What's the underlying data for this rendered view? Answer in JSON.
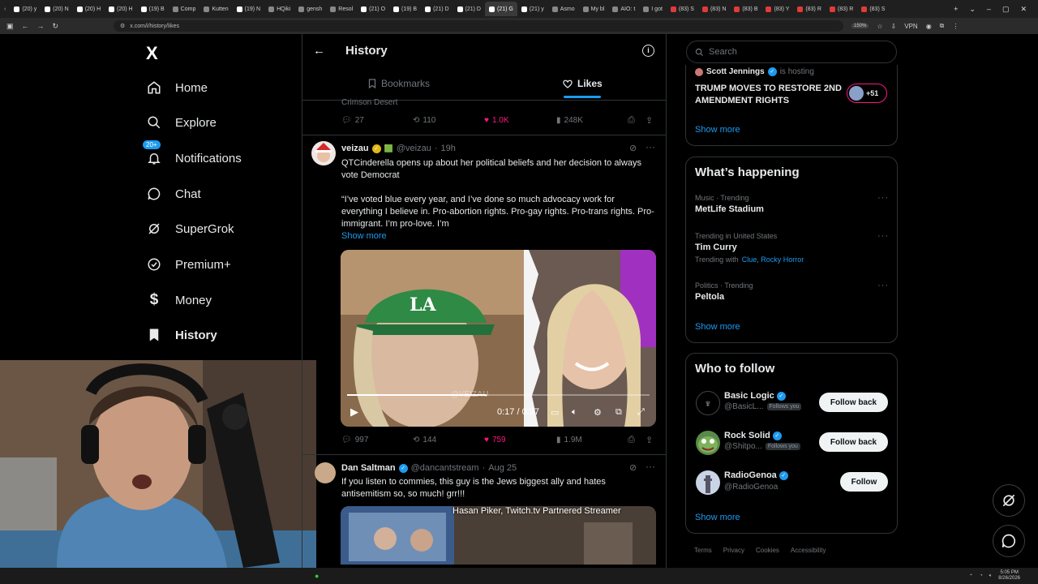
{
  "browser": {
    "tabs": [
      "(20) y",
      "(20) N",
      "(20) H",
      "(20) H",
      "(19) B",
      "Comp",
      "Kutten",
      "(19) N",
      "HQiki",
      "gensh",
      "Resol",
      "(21) O",
      "(19) B",
      "(21) D",
      "(21) D",
      "(21) G",
      "(21) y",
      "Asmo",
      "My bl",
      "AIO: t",
      "I got",
      "(83) S",
      "(83) N",
      "(83) B",
      "(83) Y",
      "(83) R",
      "(83) R",
      "(83) S"
    ],
    "active_tab_index": 15,
    "url": "x.com/i/history/likes",
    "zoom": "150%",
    "vpn_label": "VPN"
  },
  "sidebar": {
    "logo": "X",
    "items": [
      {
        "label": "Home",
        "icon": "home-icon"
      },
      {
        "label": "Explore",
        "icon": "search-icon"
      },
      {
        "label": "Notifications",
        "icon": "bell-icon",
        "badge": "20+"
      },
      {
        "label": "Chat",
        "icon": "chat-icon"
      },
      {
        "label": "SuperGrok",
        "icon": "grok-icon"
      },
      {
        "label": "Premium+",
        "icon": "premium-icon"
      },
      {
        "label": "Money",
        "icon": "money-icon"
      },
      {
        "label": "History",
        "icon": "bookmark-icon"
      }
    ]
  },
  "header": {
    "title": "History",
    "tabs": [
      {
        "label": "Bookmarks",
        "icon": "bookmark-icon",
        "active": false
      },
      {
        "label": "Likes",
        "icon": "heart-icon",
        "active": true
      }
    ]
  },
  "tweets": {
    "prev": {
      "partial_text": "Crimson Desert",
      "replies": "27",
      "retweets": "110",
      "likes": "1.0K",
      "views": "248K"
    },
    "t1": {
      "name": "veizau",
      "handle": "@veizau",
      "time": "19h",
      "text1": "QTCinderella opens up about her political beliefs and her decision to always vote Democrat",
      "text2": "“I’ve voted blue every year, and I’ve done so much advocacy work for everything I believe in. Pro-abortion rights. Pro-gay rights. Pro-trans rights. Pro-immigrant. I’m pro-love. I’m",
      "show_more": "Show more",
      "video_time": "0:17 / 0:37",
      "video_progress": 0.46,
      "video_watermark": "@VEIZAU",
      "replies": "997",
      "retweets": "144",
      "likes": "759",
      "views": "1.9M"
    },
    "t2": {
      "name": "Dan Saltman",
      "handle": "@dancantstream",
      "time": "Aug 25",
      "text": "If you listen to commies, this guy is the Jews biggest ally and hates antisemitism so, so much! grr!!!",
      "video_caption": "Hasan Piker, Twitch.tv Partnered Streamer"
    }
  },
  "right": {
    "search_placeholder": "Search",
    "space": {
      "host": "Scott Jennings",
      "status": "is hosting",
      "title": "TRUMP MOVES TO RESTORE 2ND AMENDMENT RIGHTS",
      "listeners": "+51",
      "show_more": "Show more"
    },
    "happening": {
      "title": "What’s happening",
      "trends": [
        {
          "context": "Music · Trending",
          "name": "MetLife Stadium"
        },
        {
          "context": "Trending in United States",
          "name": "Tim Curry",
          "with_label": "Trending with",
          "with": "Clue, Rocky Horror"
        },
        {
          "context": "Politics · Trending",
          "name": "Peltola"
        }
      ],
      "show_more": "Show more"
    },
    "who_to_follow": {
      "title": "Who to follow",
      "users": [
        {
          "name": "Basic Logic",
          "handle": "@BasicL...",
          "follows_you": "Follows you",
          "button": "Follow back"
        },
        {
          "name": "Rock Solid",
          "handle": "@Shitpo...",
          "follows_you": "Follows you",
          "button": "Follow back"
        },
        {
          "name": "RadioGenoa",
          "handle": "@RadioGenoa",
          "follows_you": "",
          "button": "Follow"
        }
      ],
      "show_more": "Show more"
    },
    "footer": [
      "Terms",
      "Privacy",
      "Cookies",
      "Accessibility"
    ]
  },
  "taskbar": {
    "time": "5:05 PM",
    "date": "8/26/2026"
  }
}
